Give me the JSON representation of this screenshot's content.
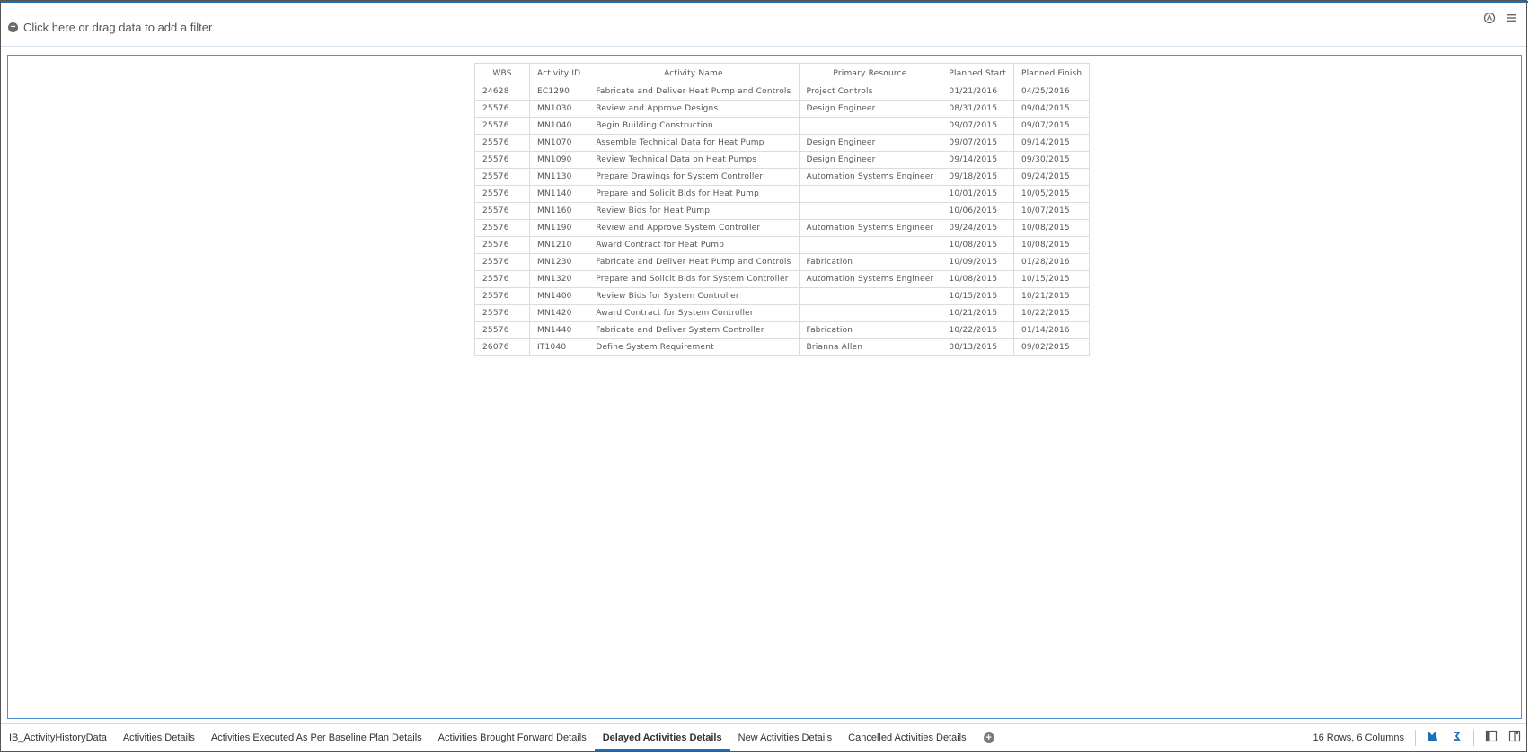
{
  "filter": {
    "add_label": "Click here or drag data to add a filter"
  },
  "table": {
    "headers": [
      "WBS",
      "Activity ID",
      "Activity Name",
      "Primary Resource",
      "Planned Start",
      "Planned Finish"
    ],
    "rows": [
      [
        "24628",
        "EC1290",
        "Fabricate and Deliver Heat Pump and Controls",
        "Project Controls",
        "01/21/2016",
        "04/25/2016"
      ],
      [
        "25576",
        "MN1030",
        "Review and Approve Designs",
        "Design Engineer",
        "08/31/2015",
        "09/04/2015"
      ],
      [
        "25576",
        "MN1040",
        "Begin Building Construction",
        "",
        "09/07/2015",
        "09/07/2015"
      ],
      [
        "25576",
        "MN1070",
        "Assemble Technical Data for Heat Pump",
        "Design Engineer",
        "09/07/2015",
        "09/14/2015"
      ],
      [
        "25576",
        "MN1090",
        "Review Technical Data on Heat Pumps",
        "Design Engineer",
        "09/14/2015",
        "09/30/2015"
      ],
      [
        "25576",
        "MN1130",
        "Prepare Drawings for System Controller",
        "Automation Systems Engineer",
        "09/18/2015",
        "09/24/2015"
      ],
      [
        "25576",
        "MN1140",
        "Prepare and Solicit Bids for Heat Pump",
        "",
        "10/01/2015",
        "10/05/2015"
      ],
      [
        "25576",
        "MN1160",
        "Review Bids for Heat Pump",
        "",
        "10/06/2015",
        "10/07/2015"
      ],
      [
        "25576",
        "MN1190",
        "Review and Approve System Controller",
        "Automation Systems Engineer",
        "09/24/2015",
        "10/08/2015"
      ],
      [
        "25576",
        "MN1210",
        "Award Contract for Heat Pump",
        "",
        "10/08/2015",
        "10/08/2015"
      ],
      [
        "25576",
        "MN1230",
        "Fabricate and Deliver Heat Pump and Controls",
        "Fabrication",
        "10/09/2015",
        "01/28/2016"
      ],
      [
        "25576",
        "MN1320",
        "Prepare and Solicit Bids for System Controller",
        "Automation Systems Engineer",
        "10/08/2015",
        "10/15/2015"
      ],
      [
        "25576",
        "MN1400",
        "Review Bids for System Controller",
        "",
        "10/15/2015",
        "10/21/2015"
      ],
      [
        "25576",
        "MN1420",
        "Award Contract for System Controller",
        "",
        "10/21/2015",
        "10/22/2015"
      ],
      [
        "25576",
        "MN1440",
        "Fabricate and Deliver System Controller",
        "Fabrication",
        "10/22/2015",
        "01/14/2016"
      ],
      [
        "26076",
        "IT1040",
        "Define System Requirement",
        "Brianna Allen",
        "08/13/2015",
        "09/02/2015"
      ]
    ]
  },
  "tabs": [
    {
      "label": "IB_ActivityHistoryData",
      "active": false
    },
    {
      "label": "Activities Details",
      "active": false
    },
    {
      "label": "Activities Executed As Per Baseline Plan Details",
      "active": false
    },
    {
      "label": "Activities Brought Forward Details",
      "active": false
    },
    {
      "label": "Delayed Activities Details",
      "active": true
    },
    {
      "label": "New Activities Details",
      "active": false
    },
    {
      "label": "Cancelled Activities Details",
      "active": false
    }
  ],
  "status": {
    "summary": "16 Rows, 6 Columns"
  },
  "colors": {
    "accent": "#1f6fb8",
    "border": "#4b93d0"
  },
  "icons": [
    "plus-circle-icon",
    "share-icon",
    "menu-icon",
    "add-tab-icon",
    "explore-icon",
    "refresh-icon",
    "single-pane-icon",
    "split-pane-icon"
  ]
}
